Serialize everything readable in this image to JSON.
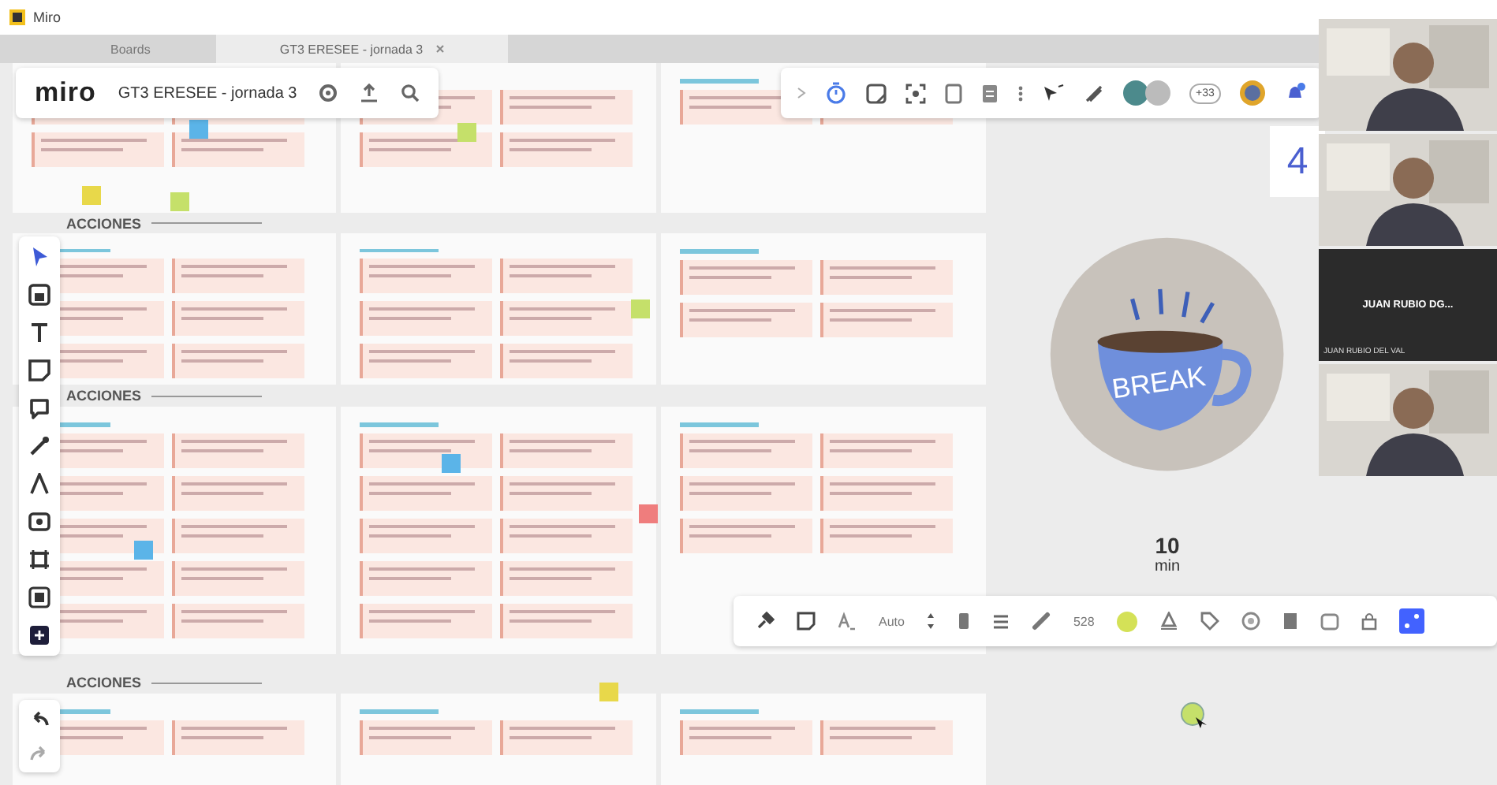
{
  "window": {
    "title": "Miro"
  },
  "tabs": [
    {
      "label": "Boards",
      "selected": false
    },
    {
      "label": "GT3 ERESEE - jornada 3",
      "selected": true
    }
  ],
  "board_header": {
    "logo": "miro",
    "title": "GT3 ERESEE - jornada 3"
  },
  "top_toolbar": {
    "collaborators_count": "+33"
  },
  "sections": [
    {
      "title": "ACCIONES"
    },
    {
      "title": "ACCIONES"
    },
    {
      "title": "ACCIONES"
    }
  ],
  "side_panel": {
    "value": "4"
  },
  "break_card": {
    "label": "BREAK",
    "duration": "10",
    "unit": "min"
  },
  "context_toolbar": {
    "font": "Auto",
    "size": "528",
    "color": "#d4e157"
  },
  "video_tiles": [
    {
      "kind": "camera"
    },
    {
      "kind": "camera"
    },
    {
      "kind": "name",
      "initials": "JUAN RUBIO DG...",
      "caption": "JUAN RUBIO DEL VAL"
    },
    {
      "kind": "camera"
    }
  ]
}
